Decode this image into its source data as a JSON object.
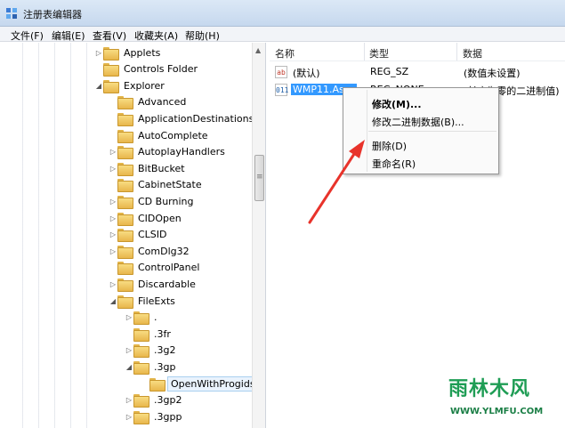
{
  "window": {
    "title": "注册表编辑器",
    "app_icon": "regedit-icon"
  },
  "menu": [
    "文件(F)",
    "编辑(E)",
    "查看(V)",
    "收藏夹(A)",
    "帮助(H)"
  ],
  "tree": [
    {
      "label": "Applets",
      "expander": "collapsed",
      "level": 0
    },
    {
      "label": "Controls Folder",
      "expander": "none",
      "level": 0
    },
    {
      "label": "Explorer",
      "expander": "expanded",
      "level": 0
    },
    {
      "label": "Advanced",
      "expander": "none",
      "level": 1
    },
    {
      "label": "ApplicationDestinations",
      "expander": "none",
      "level": 1
    },
    {
      "label": "AutoComplete",
      "expander": "none",
      "level": 1
    },
    {
      "label": "AutoplayHandlers",
      "expander": "collapsed",
      "level": 1
    },
    {
      "label": "BitBucket",
      "expander": "collapsed",
      "level": 1
    },
    {
      "label": "CabinetState",
      "expander": "none",
      "level": 1
    },
    {
      "label": "CD Burning",
      "expander": "collapsed",
      "level": 1
    },
    {
      "label": "CIDOpen",
      "expander": "collapsed",
      "level": 1
    },
    {
      "label": "CLSID",
      "expander": "collapsed",
      "level": 1
    },
    {
      "label": "ComDlg32",
      "expander": "collapsed",
      "level": 1
    },
    {
      "label": "ControlPanel",
      "expander": "none",
      "level": 1
    },
    {
      "label": "Discardable",
      "expander": "collapsed",
      "level": 1
    },
    {
      "label": "FileExts",
      "expander": "expanded",
      "level": 1
    },
    {
      "label": ".",
      "expander": "collapsed",
      "level": 2
    },
    {
      "label": ".3fr",
      "expander": "none",
      "level": 2
    },
    {
      "label": ".3g2",
      "expander": "collapsed",
      "level": 2
    },
    {
      "label": ".3gp",
      "expander": "expanded",
      "level": 2
    },
    {
      "label": "OpenWithProgids",
      "expander": "none",
      "level": 3,
      "selected": true
    },
    {
      "label": ".3gp2",
      "expander": "collapsed",
      "level": 2
    },
    {
      "label": ".3gpp",
      "expander": "collapsed",
      "level": 2
    }
  ],
  "list": {
    "headers": {
      "name": "名称",
      "type": "类型",
      "data": "数据"
    },
    "rows": [
      {
        "icon": "string-value-icon",
        "icon_text": "ab",
        "name": "(默认)",
        "type": "REG_SZ",
        "data": "(数值未设置)"
      },
      {
        "icon": "binary-value-icon",
        "icon_text": "011",
        "name": "WMP11.Asso",
        "type": "REG_NONE",
        "data": "(长度为零的二进制值)",
        "selected": true
      }
    ]
  },
  "context_menu": {
    "items": [
      "修改(M)...",
      "修改二进制数据(B)...",
      "删除(D)",
      "重命名(R)"
    ]
  },
  "annotation_color": "#e8332b",
  "watermark": {
    "logo": "雨林木风",
    "url": "WWW.YLMFU.COM"
  }
}
